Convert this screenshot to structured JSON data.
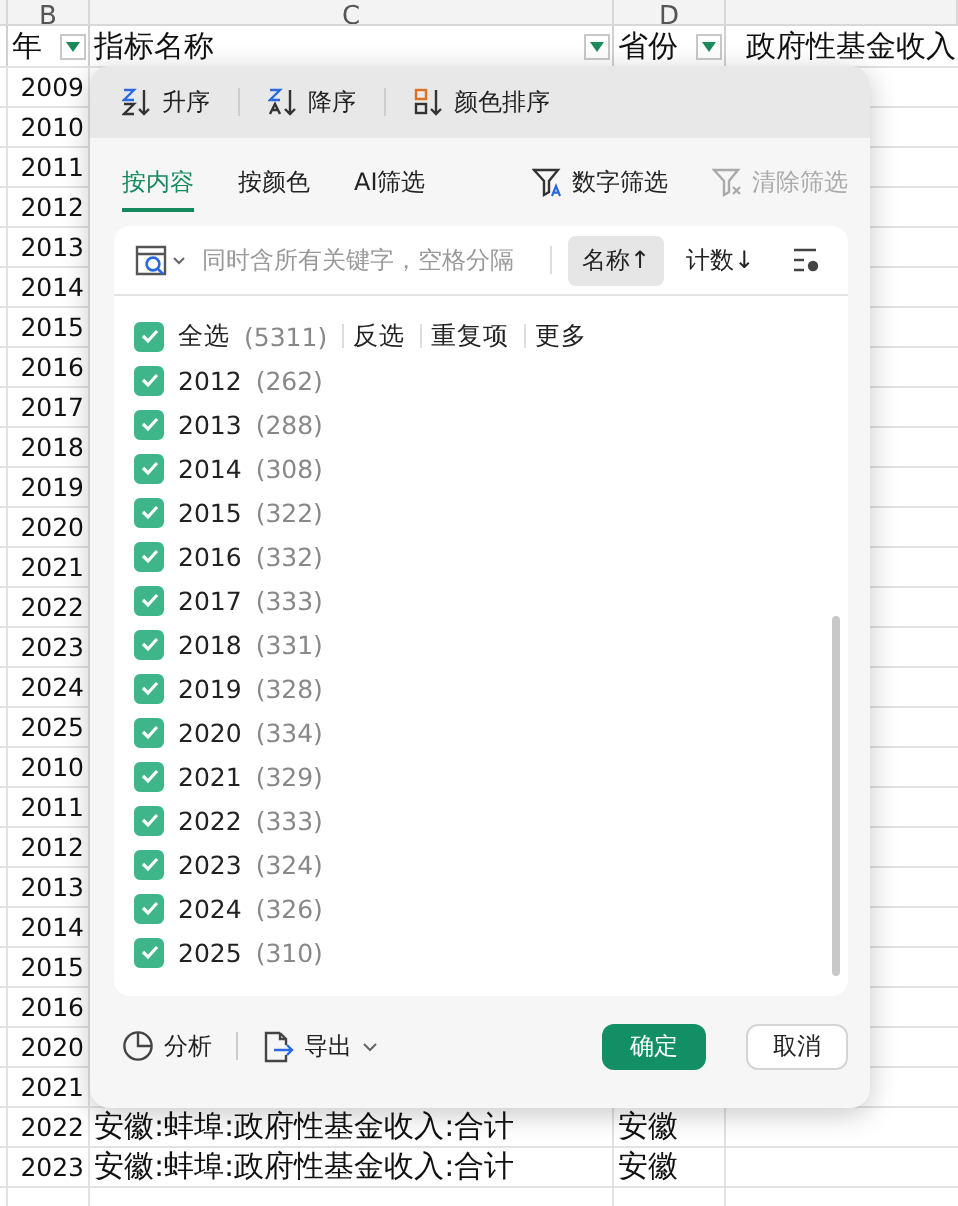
{
  "sheet": {
    "column_letters": [
      "B",
      "C",
      "D"
    ],
    "header": [
      "年",
      "指标名称",
      "省份",
      "政府性基金收入"
    ],
    "rows": [
      {
        "year": "2009"
      },
      {
        "year": "2010"
      },
      {
        "year": "2011"
      },
      {
        "year": "2012"
      },
      {
        "year": "2013"
      },
      {
        "year": "2014"
      },
      {
        "year": "2015"
      },
      {
        "year": "2016"
      },
      {
        "year": "2017"
      },
      {
        "year": "2018"
      },
      {
        "year": "2019"
      },
      {
        "year": "2020"
      },
      {
        "year": "2021"
      },
      {
        "year": "2022"
      },
      {
        "year": "2023"
      },
      {
        "year": "2024"
      },
      {
        "year": "2025"
      },
      {
        "year": "2010"
      },
      {
        "year": "2011"
      },
      {
        "year": "2012"
      },
      {
        "year": "2013"
      },
      {
        "year": "2014"
      },
      {
        "year": "2015"
      },
      {
        "year": "2016"
      },
      {
        "year": "2020"
      },
      {
        "year": "2021"
      },
      {
        "year": "2022",
        "name": "安徽:蚌埠:政府性基金收入:合计",
        "province": "安徽"
      },
      {
        "year": "2023",
        "name": "安徽:蚌埠:政府性基金收入:合计",
        "province": "安徽"
      }
    ]
  },
  "filter_popup": {
    "sort_buttons": [
      {
        "kind": "asc",
        "label": "升序"
      },
      {
        "kind": "desc",
        "label": "降序"
      },
      {
        "kind": "color",
        "label": "颜色排序"
      }
    ],
    "tabs": [
      {
        "label": "按内容",
        "selected": true
      },
      {
        "label": "按颜色",
        "selected": false
      },
      {
        "label": "AI筛选",
        "selected": false
      }
    ],
    "number_filter": "数字筛选",
    "clear_filter": {
      "label": "清除筛选",
      "disabled": true
    },
    "search": {
      "placeholder": "同时含所有关键字，空格分隔"
    },
    "sort_toggles": [
      {
        "label": "名称↑",
        "selected": true
      },
      {
        "label": "计数↓",
        "selected": false
      }
    ],
    "select_all": {
      "label": "全选",
      "count": "(5311)",
      "checked": true
    },
    "actions": [
      "反选",
      "重复项",
      "更多"
    ],
    "items": [
      {
        "label": "2012",
        "count": "(262)",
        "checked": true
      },
      {
        "label": "2013",
        "count": "(288)",
        "checked": true
      },
      {
        "label": "2014",
        "count": "(308)",
        "checked": true
      },
      {
        "label": "2015",
        "count": "(322)",
        "checked": true
      },
      {
        "label": "2016",
        "count": "(332)",
        "checked": true
      },
      {
        "label": "2017",
        "count": "(333)",
        "checked": true
      },
      {
        "label": "2018",
        "count": "(331)",
        "checked": true
      },
      {
        "label": "2019",
        "count": "(328)",
        "checked": true
      },
      {
        "label": "2020",
        "count": "(334)",
        "checked": true
      },
      {
        "label": "2021",
        "count": "(329)",
        "checked": true
      },
      {
        "label": "2022",
        "count": "(333)",
        "checked": true
      },
      {
        "label": "2023",
        "count": "(324)",
        "checked": true
      },
      {
        "label": "2024",
        "count": "(326)",
        "checked": true
      },
      {
        "label": "2025",
        "count": "(310)",
        "checked": true
      }
    ],
    "footer": {
      "analyze": "分析",
      "export": "导出",
      "ok": "确定",
      "cancel": "取消"
    }
  }
}
